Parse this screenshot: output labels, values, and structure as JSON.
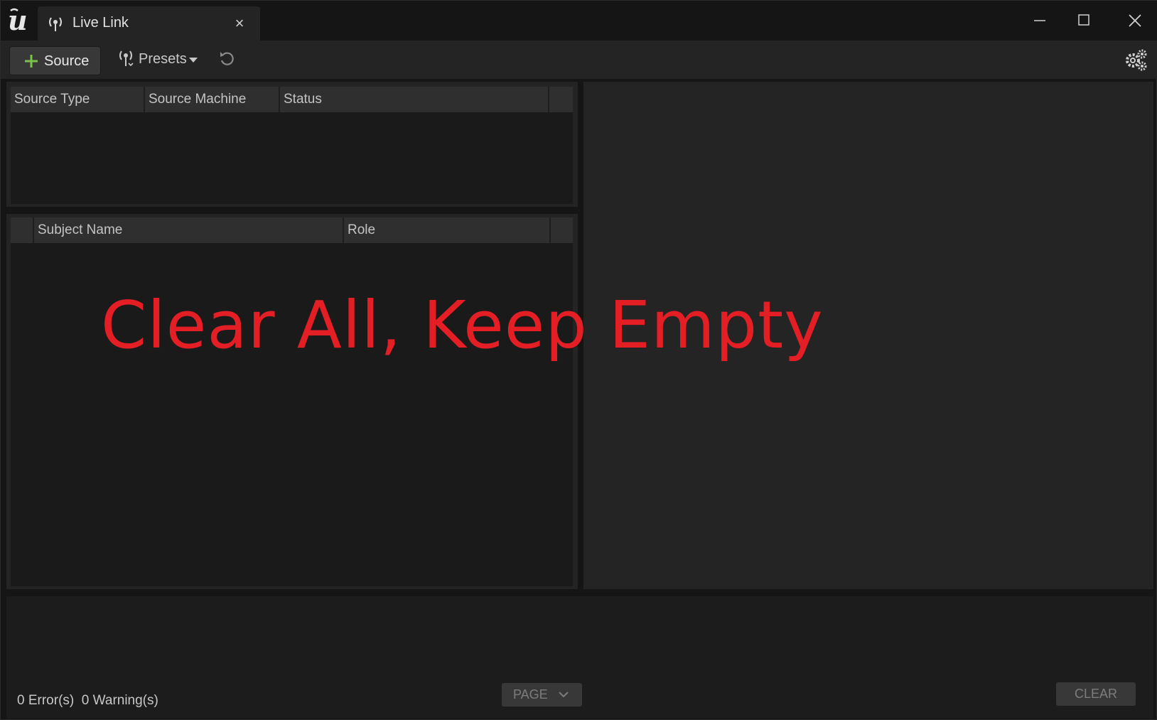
{
  "window": {
    "tab_title": "Live Link",
    "tab_close_glyph": "×"
  },
  "toolbar": {
    "source_label": "Source",
    "presets_label": "Presets"
  },
  "sources_table": {
    "columns": [
      "Source Type",
      "Source Machine",
      "Status"
    ]
  },
  "subjects_table": {
    "columns": [
      "Subject Name",
      "Role"
    ]
  },
  "output_log": {
    "errors_text": "0 Error(s)",
    "warnings_text": "0 Warning(s)",
    "page_label": "PAGE",
    "clear_label": "CLEAR"
  },
  "overlay": {
    "text": "Clear All, Keep Empty",
    "color": "#e41e25"
  },
  "colors": {
    "accent_green": "#7bc14a"
  },
  "icons": [
    "unreal-logo-icon",
    "live-link-icon",
    "close-icon",
    "minimize-icon",
    "maximize-icon",
    "plus-icon",
    "presets-icon",
    "caret-down-icon",
    "reset-icon",
    "settings-icon",
    "chevron-down-icon"
  ]
}
